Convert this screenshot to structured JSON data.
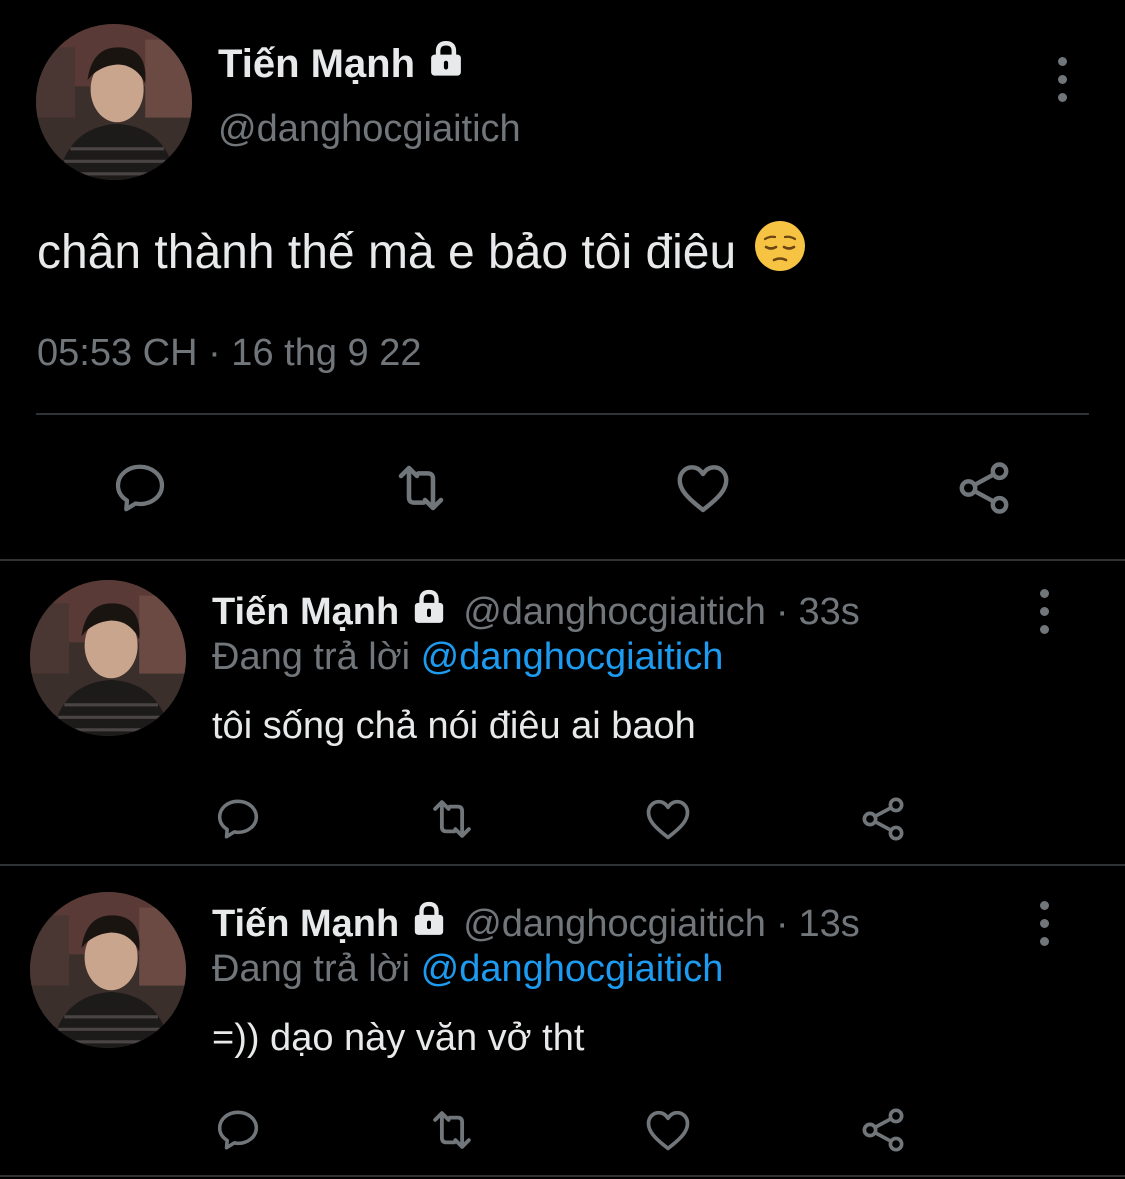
{
  "main_tweet": {
    "display_name": "Tiến Mạnh",
    "handle": "@danghocgiaitich",
    "text": "chân thành thế mà e bảo tôi điêu",
    "emoji": "pensive-face",
    "timestamp": "05:53 CH · 16 thg 9 22",
    "avatar": "profile-photo",
    "lock_icon": "lock-icon"
  },
  "replies": [
    {
      "display_name": "Tiến Mạnh",
      "handle": "@danghocgiaitich",
      "separator": "·",
      "time": "33s",
      "replying_to_label": "Đang trả lời",
      "replying_to_handle": "@danghocgiaitich",
      "text": "tôi sống chả nói điêu ai baoh"
    },
    {
      "display_name": "Tiến Mạnh",
      "handle": "@danghocgiaitich",
      "separator": "·",
      "time": "13s",
      "replying_to_label": "Đang trả lời",
      "replying_to_handle": "@danghocgiaitich",
      "text": "=)) dạo này văn vở tht"
    }
  ],
  "actions": [
    "reply-icon",
    "retweet-icon",
    "like-icon",
    "share-icon"
  ],
  "colors": {
    "background": "#000000",
    "text": "#e7e9ea",
    "secondary": "#71767b",
    "mention": "#1d9bf0",
    "divider": "#2f3336"
  }
}
